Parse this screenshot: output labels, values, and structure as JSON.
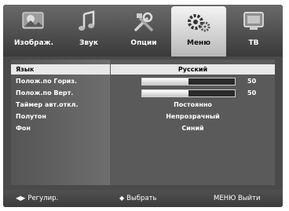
{
  "tabs": [
    {
      "label": "Изображ.",
      "icon": "picture-icon",
      "active": false
    },
    {
      "label": "Звук",
      "icon": "sound-icon",
      "active": false
    },
    {
      "label": "Опции",
      "icon": "options-icon",
      "active": false
    },
    {
      "label": "Меню",
      "icon": "menu-icon",
      "active": true
    },
    {
      "label": "ТВ",
      "icon": "tv-icon",
      "active": false
    }
  ],
  "menu": {
    "rows": [
      {
        "label": "Язык",
        "value": "Русский",
        "selected": true
      },
      {
        "label": "Полож.по Гориз.",
        "slider_value": "50",
        "slider_fraction": 0.5
      },
      {
        "label": "Полож.по Верт.",
        "slider_value": "50",
        "slider_fraction": 0.5
      },
      {
        "label": "Таймер авт.откл.",
        "value": "Постоянно"
      },
      {
        "label": "Полутон",
        "value": "Непрозрачный"
      },
      {
        "label": "Фон",
        "value": "Синий"
      }
    ]
  },
  "footer": {
    "adjust_glyph": "◀▶",
    "adjust_label": "Регулир.",
    "select_glyph": "◆",
    "select_label": "Выбрать",
    "exit_label": "МЕНЮ Выйти"
  },
  "colors": {
    "background": "#4a4a4a",
    "highlight": "#e8e8e8",
    "text": "#ffffff"
  }
}
